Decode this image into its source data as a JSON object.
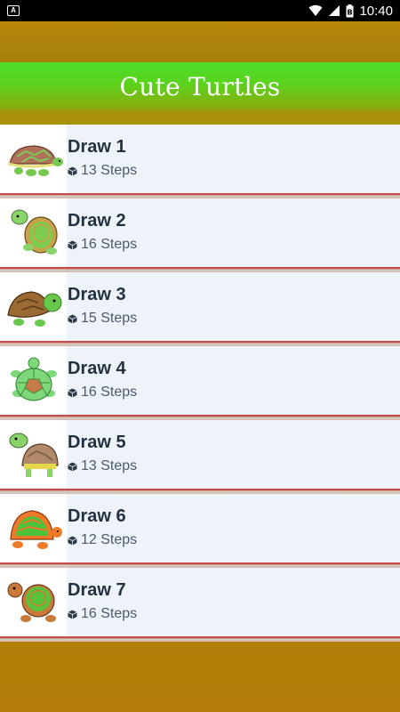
{
  "status_bar": {
    "time": "10:40",
    "notification_icon": "notification-a-icon",
    "battery_label": "B"
  },
  "app_bar": {
    "title": "Cute Turtles"
  },
  "drawings": [
    {
      "title": "Draw 1",
      "steps": "13 Steps",
      "thumbnail": "turtle-thumbnail-1"
    },
    {
      "title": "Draw 2",
      "steps": "16 Steps",
      "thumbnail": "turtle-thumbnail-2"
    },
    {
      "title": "Draw 3",
      "steps": "15 Steps",
      "thumbnail": "turtle-thumbnail-3"
    },
    {
      "title": "Draw 4",
      "steps": "16 Steps",
      "thumbnail": "turtle-thumbnail-4"
    },
    {
      "title": "Draw 5",
      "steps": "13 Steps",
      "thumbnail": "turtle-thumbnail-5"
    },
    {
      "title": "Draw 6",
      "steps": "12 Steps",
      "thumbnail": "turtle-thumbnail-6"
    },
    {
      "title": "Draw 7",
      "steps": "16 Steps",
      "thumbnail": "turtle-thumbnail-7"
    }
  ],
  "colors": {
    "app_bar_green": "#4ddd2a",
    "background_gold": "#b8860b",
    "card_background": "#eef2f9",
    "separator_red": "#c64c4c"
  }
}
